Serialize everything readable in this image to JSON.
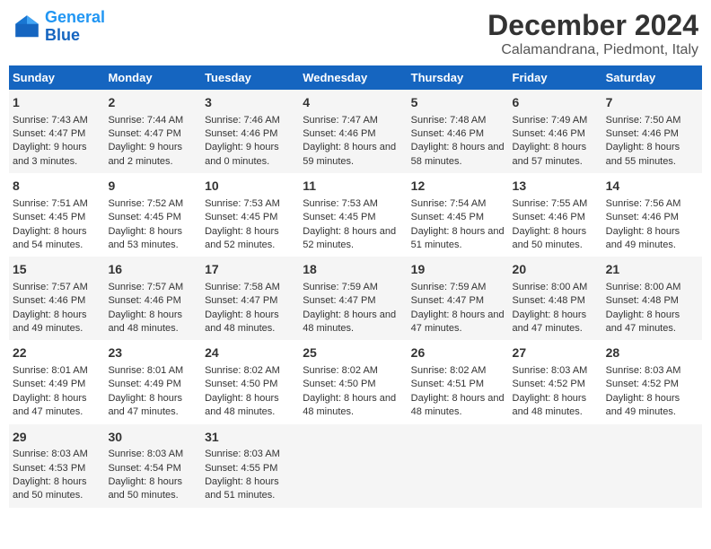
{
  "header": {
    "logo_line1": "General",
    "logo_line2": "Blue",
    "title": "December 2024",
    "subtitle": "Calamandrana, Piedmont, Italy"
  },
  "calendar": {
    "days_of_week": [
      "Sunday",
      "Monday",
      "Tuesday",
      "Wednesday",
      "Thursday",
      "Friday",
      "Saturday"
    ],
    "weeks": [
      [
        {
          "day": "1",
          "sunrise": "Sunrise: 7:43 AM",
          "sunset": "Sunset: 4:47 PM",
          "daylight": "Daylight: 9 hours and 3 minutes."
        },
        {
          "day": "2",
          "sunrise": "Sunrise: 7:44 AM",
          "sunset": "Sunset: 4:47 PM",
          "daylight": "Daylight: 9 hours and 2 minutes."
        },
        {
          "day": "3",
          "sunrise": "Sunrise: 7:46 AM",
          "sunset": "Sunset: 4:46 PM",
          "daylight": "Daylight: 9 hours and 0 minutes."
        },
        {
          "day": "4",
          "sunrise": "Sunrise: 7:47 AM",
          "sunset": "Sunset: 4:46 PM",
          "daylight": "Daylight: 8 hours and 59 minutes."
        },
        {
          "day": "5",
          "sunrise": "Sunrise: 7:48 AM",
          "sunset": "Sunset: 4:46 PM",
          "daylight": "Daylight: 8 hours and 58 minutes."
        },
        {
          "day": "6",
          "sunrise": "Sunrise: 7:49 AM",
          "sunset": "Sunset: 4:46 PM",
          "daylight": "Daylight: 8 hours and 57 minutes."
        },
        {
          "day": "7",
          "sunrise": "Sunrise: 7:50 AM",
          "sunset": "Sunset: 4:46 PM",
          "daylight": "Daylight: 8 hours and 55 minutes."
        }
      ],
      [
        {
          "day": "8",
          "sunrise": "Sunrise: 7:51 AM",
          "sunset": "Sunset: 4:45 PM",
          "daylight": "Daylight: 8 hours and 54 minutes."
        },
        {
          "day": "9",
          "sunrise": "Sunrise: 7:52 AM",
          "sunset": "Sunset: 4:45 PM",
          "daylight": "Daylight: 8 hours and 53 minutes."
        },
        {
          "day": "10",
          "sunrise": "Sunrise: 7:53 AM",
          "sunset": "Sunset: 4:45 PM",
          "daylight": "Daylight: 8 hours and 52 minutes."
        },
        {
          "day": "11",
          "sunrise": "Sunrise: 7:53 AM",
          "sunset": "Sunset: 4:45 PM",
          "daylight": "Daylight: 8 hours and 52 minutes."
        },
        {
          "day": "12",
          "sunrise": "Sunrise: 7:54 AM",
          "sunset": "Sunset: 4:45 PM",
          "daylight": "Daylight: 8 hours and 51 minutes."
        },
        {
          "day": "13",
          "sunrise": "Sunrise: 7:55 AM",
          "sunset": "Sunset: 4:46 PM",
          "daylight": "Daylight: 8 hours and 50 minutes."
        },
        {
          "day": "14",
          "sunrise": "Sunrise: 7:56 AM",
          "sunset": "Sunset: 4:46 PM",
          "daylight": "Daylight: 8 hours and 49 minutes."
        }
      ],
      [
        {
          "day": "15",
          "sunrise": "Sunrise: 7:57 AM",
          "sunset": "Sunset: 4:46 PM",
          "daylight": "Daylight: 8 hours and 49 minutes."
        },
        {
          "day": "16",
          "sunrise": "Sunrise: 7:57 AM",
          "sunset": "Sunset: 4:46 PM",
          "daylight": "Daylight: 8 hours and 48 minutes."
        },
        {
          "day": "17",
          "sunrise": "Sunrise: 7:58 AM",
          "sunset": "Sunset: 4:47 PM",
          "daylight": "Daylight: 8 hours and 48 minutes."
        },
        {
          "day": "18",
          "sunrise": "Sunrise: 7:59 AM",
          "sunset": "Sunset: 4:47 PM",
          "daylight": "Daylight: 8 hours and 48 minutes."
        },
        {
          "day": "19",
          "sunrise": "Sunrise: 7:59 AM",
          "sunset": "Sunset: 4:47 PM",
          "daylight": "Daylight: 8 hours and 47 minutes."
        },
        {
          "day": "20",
          "sunrise": "Sunrise: 8:00 AM",
          "sunset": "Sunset: 4:48 PM",
          "daylight": "Daylight: 8 hours and 47 minutes."
        },
        {
          "day": "21",
          "sunrise": "Sunrise: 8:00 AM",
          "sunset": "Sunset: 4:48 PM",
          "daylight": "Daylight: 8 hours and 47 minutes."
        }
      ],
      [
        {
          "day": "22",
          "sunrise": "Sunrise: 8:01 AM",
          "sunset": "Sunset: 4:49 PM",
          "daylight": "Daylight: 8 hours and 47 minutes."
        },
        {
          "day": "23",
          "sunrise": "Sunrise: 8:01 AM",
          "sunset": "Sunset: 4:49 PM",
          "daylight": "Daylight: 8 hours and 47 minutes."
        },
        {
          "day": "24",
          "sunrise": "Sunrise: 8:02 AM",
          "sunset": "Sunset: 4:50 PM",
          "daylight": "Daylight: 8 hours and 48 minutes."
        },
        {
          "day": "25",
          "sunrise": "Sunrise: 8:02 AM",
          "sunset": "Sunset: 4:50 PM",
          "daylight": "Daylight: 8 hours and 48 minutes."
        },
        {
          "day": "26",
          "sunrise": "Sunrise: 8:02 AM",
          "sunset": "Sunset: 4:51 PM",
          "daylight": "Daylight: 8 hours and 48 minutes."
        },
        {
          "day": "27",
          "sunrise": "Sunrise: 8:03 AM",
          "sunset": "Sunset: 4:52 PM",
          "daylight": "Daylight: 8 hours and 48 minutes."
        },
        {
          "day": "28",
          "sunrise": "Sunrise: 8:03 AM",
          "sunset": "Sunset: 4:52 PM",
          "daylight": "Daylight: 8 hours and 49 minutes."
        }
      ],
      [
        {
          "day": "29",
          "sunrise": "Sunrise: 8:03 AM",
          "sunset": "Sunset: 4:53 PM",
          "daylight": "Daylight: 8 hours and 50 minutes."
        },
        {
          "day": "30",
          "sunrise": "Sunrise: 8:03 AM",
          "sunset": "Sunset: 4:54 PM",
          "daylight": "Daylight: 8 hours and 50 minutes."
        },
        {
          "day": "31",
          "sunrise": "Sunrise: 8:03 AM",
          "sunset": "Sunset: 4:55 PM",
          "daylight": "Daylight: 8 hours and 51 minutes."
        },
        null,
        null,
        null,
        null
      ]
    ]
  }
}
